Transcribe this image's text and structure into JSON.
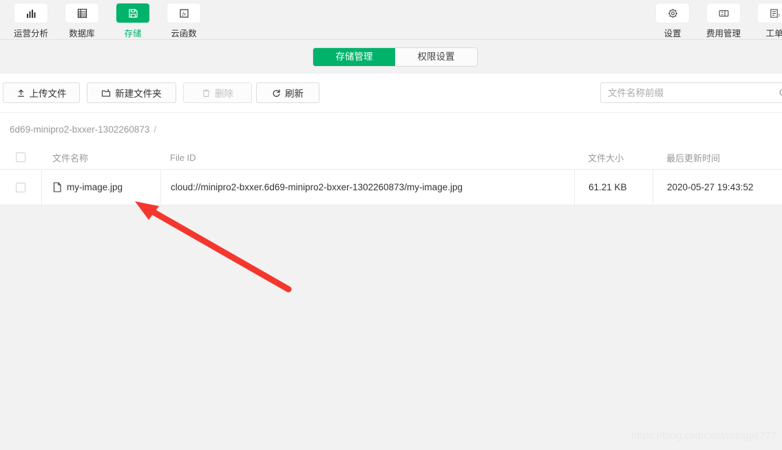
{
  "topnav": {
    "left_items": [
      {
        "label": "运营分析",
        "icon": "bar-chart-icon",
        "active": false
      },
      {
        "label": "数据库",
        "icon": "database-icon",
        "active": false
      },
      {
        "label": "存储",
        "icon": "save-icon",
        "active": true
      },
      {
        "label": "云函数",
        "icon": "function-fx-icon",
        "active": false
      }
    ],
    "right_items": [
      {
        "label": "设置",
        "icon": "gear-icon",
        "active": false
      },
      {
        "label": "费用管理",
        "icon": "billing-card-icon",
        "active": false
      },
      {
        "label": "工单",
        "icon": "ticket-doc-icon",
        "active": false
      }
    ]
  },
  "tabs": [
    {
      "label": "存储管理",
      "active": true
    },
    {
      "label": "权限设置",
      "active": false
    }
  ],
  "toolbar": {
    "upload_label": "上传文件",
    "newdir_label": "新建文件夹",
    "delete_label": "删除",
    "refresh_label": "刷新",
    "delete_disabled": true
  },
  "search": {
    "placeholder": "文件名称前缀",
    "value": ""
  },
  "breadcrumb": {
    "root": "6d69-minipro2-bxxer-1302260873",
    "separator": "/"
  },
  "table": {
    "columns": [
      "文件名称",
      "File ID",
      "文件大小",
      "最后更新时间"
    ],
    "rows": [
      {
        "name": "my-image.jpg",
        "file_id": "cloud://minipro2-bxxer.6d69-minipro2-bxxer-1302260873/my-image.jpg",
        "size": "61.21 KB",
        "updated": "2020-05-27 19:43:52",
        "selected": false
      }
    ]
  },
  "annotation": {
    "arrow_color": "#f4372e"
  },
  "watermark": {
    "text": "https://blog.csdn.net/mingjie777"
  },
  "colors": {
    "accent_green": "#00b26a",
    "page_bg": "#f2f2f2",
    "panel_bg": "#ffffff",
    "muted_text": "#999999"
  }
}
